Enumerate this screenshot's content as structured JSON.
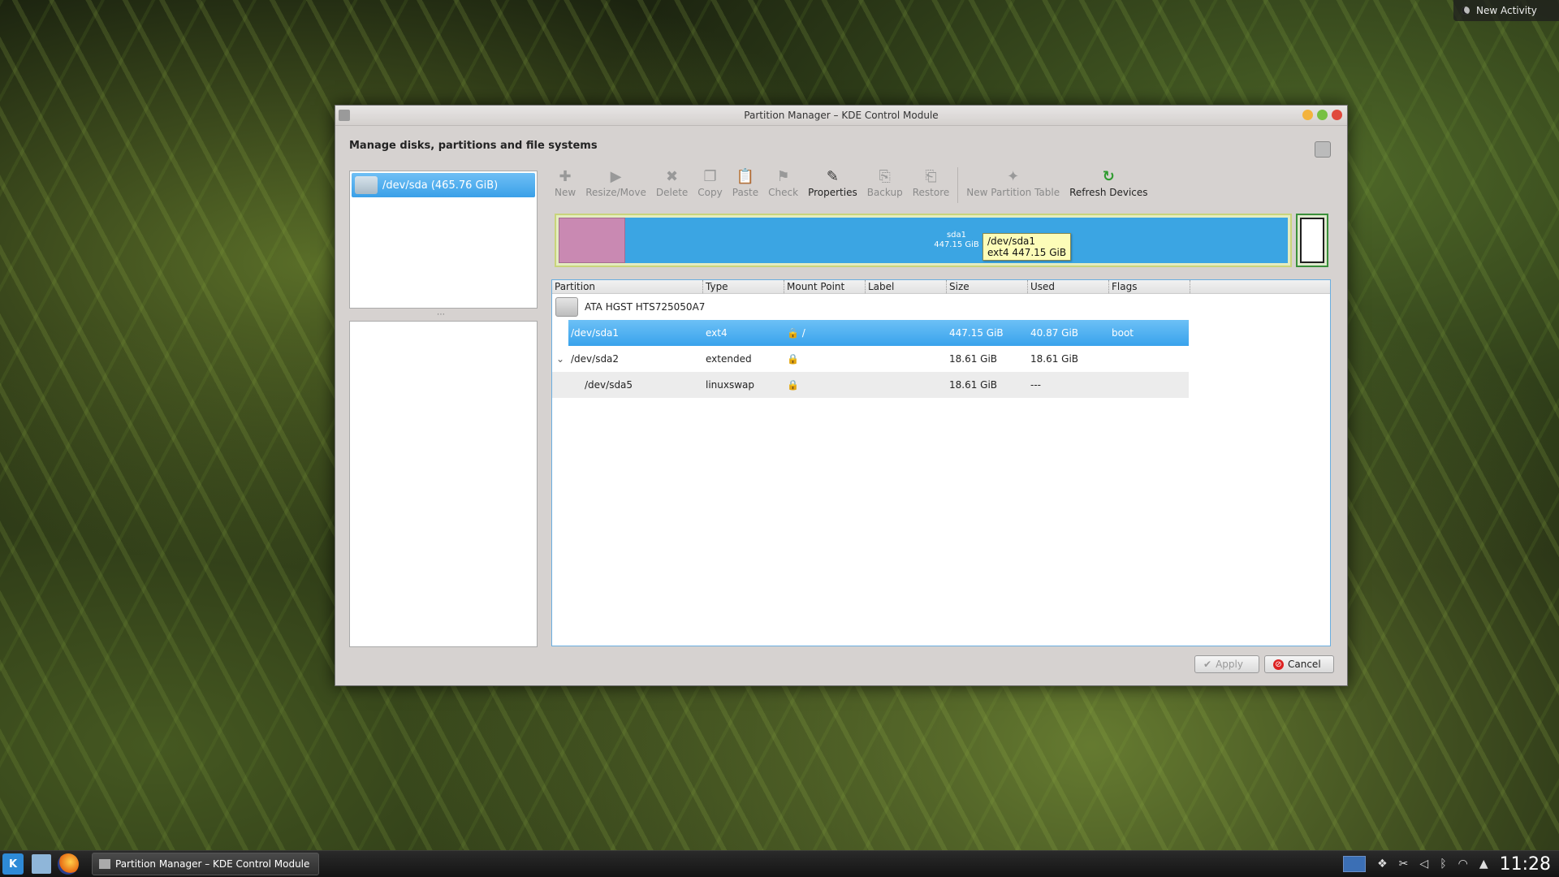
{
  "desktop": {
    "activity_label": "New Activity"
  },
  "window": {
    "title": "Partition Manager – KDE Control Module",
    "heading": "Manage disks, partitions and file systems"
  },
  "device_list": {
    "items": [
      {
        "label": "/dev/sda (465.76 GiB)"
      }
    ]
  },
  "toolbar": {
    "new": "New",
    "resize_move": "Resize/Move",
    "delete": "Delete",
    "copy": "Copy",
    "paste": "Paste",
    "check": "Check",
    "properties": "Properties",
    "backup": "Backup",
    "restore": "Restore",
    "new_partition_table": "New Partition Table",
    "refresh_devices": "Refresh Devices"
  },
  "partition_bar": {
    "segment_label": "sda1",
    "segment_size": "447.15 GiB",
    "tooltip_line1": "/dev/sda1",
    "tooltip_line2": "ext4 447.15 GiB"
  },
  "table": {
    "headers": [
      "Partition",
      "Type",
      "Mount Point",
      "Label",
      "Size",
      "Used",
      "Flags"
    ],
    "disk": "ATA HGST HTS725050A7",
    "rows": [
      {
        "partition": "/dev/sda1",
        "type": "ext4",
        "mount": "/",
        "label": "",
        "size": "447.15 GiB",
        "used": "40.87 GiB",
        "flags": "boot"
      },
      {
        "partition": "/dev/sda2",
        "type": "extended",
        "mount": "",
        "label": "",
        "size": "18.61 GiB",
        "used": "18.61 GiB",
        "flags": ""
      },
      {
        "partition": "/dev/sda5",
        "type": "linuxswap",
        "mount": "",
        "label": "",
        "size": "18.61 GiB",
        "used": "---",
        "flags": ""
      }
    ]
  },
  "buttons": {
    "apply": "Apply",
    "cancel": "Cancel"
  },
  "taskbar": {
    "task_label": "Partition Manager – KDE Control Module",
    "clock": "11:28"
  },
  "colors": {
    "selection": "#3ba5e3",
    "partition_used": "#c989b2",
    "accent_green": "#2f9b2f"
  }
}
